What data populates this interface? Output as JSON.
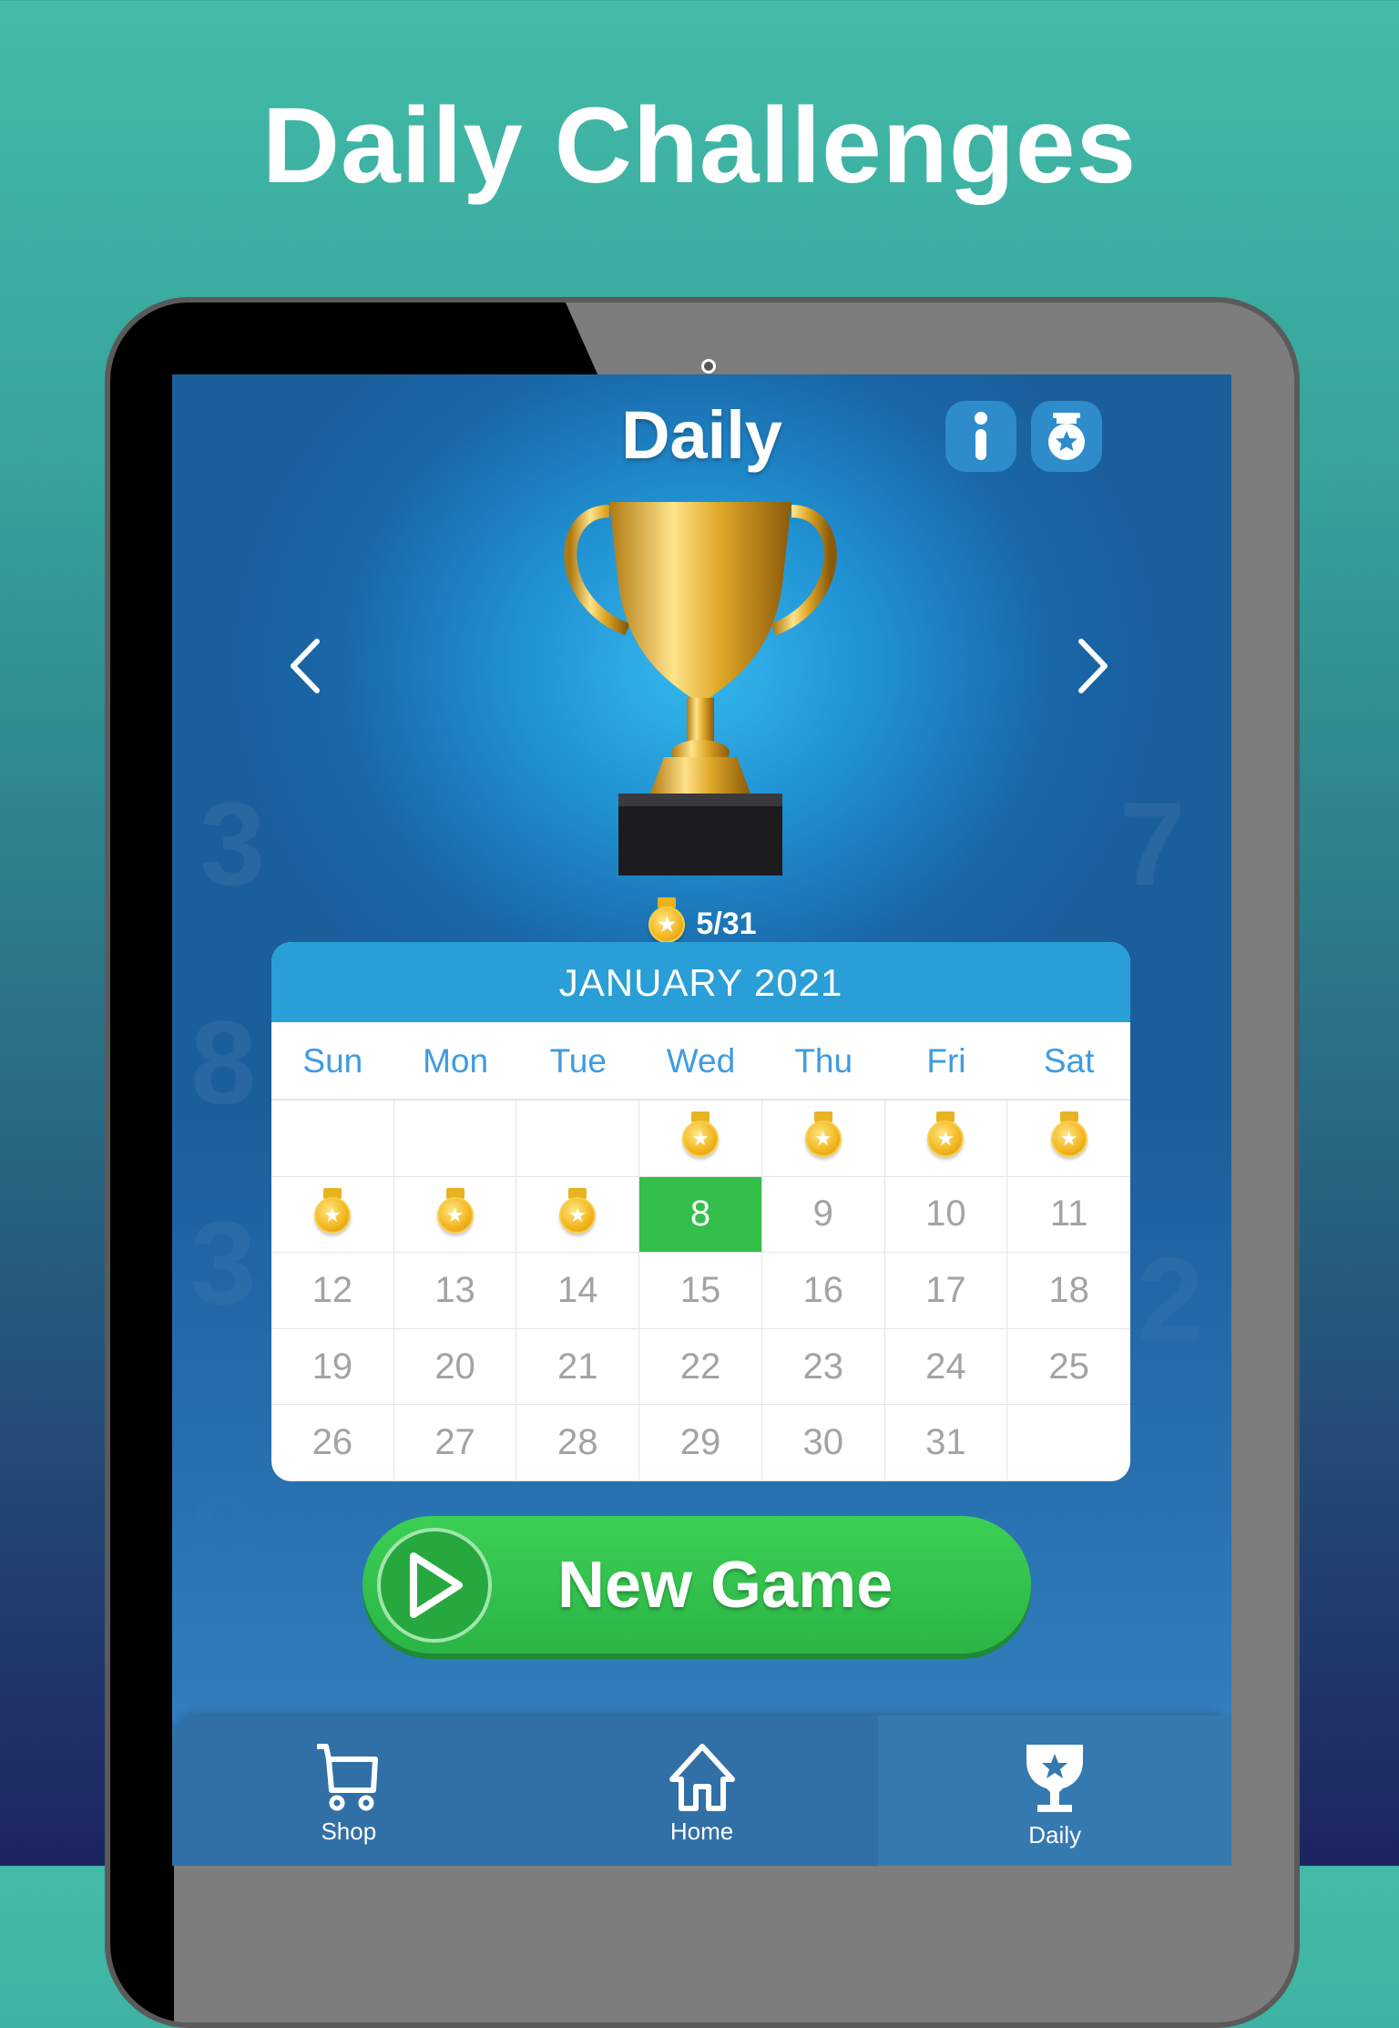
{
  "promo_title": "Daily Challenges",
  "screen": {
    "title": "Daily",
    "buttons": {
      "info_icon": "info-icon",
      "medal_jar_icon": "medal-jar-icon"
    },
    "progress": {
      "completed": 5,
      "total": 31,
      "label": "5/31"
    },
    "calendar": {
      "month_label": "JANUARY 2021",
      "weekdays": [
        "Sun",
        "Mon",
        "Tue",
        "Wed",
        "Thu",
        "Fri",
        "Sat"
      ],
      "today": 8,
      "completed_days": [
        1,
        2,
        3,
        4,
        5,
        6,
        7
      ],
      "cells": [
        "",
        "",
        "",
        "1",
        "2",
        "3",
        "4",
        "5",
        "6",
        "7",
        "8",
        "9",
        "10",
        "11",
        "12",
        "13",
        "14",
        "15",
        "16",
        "17",
        "18",
        "19",
        "20",
        "21",
        "22",
        "23",
        "24",
        "25",
        "26",
        "27",
        "28",
        "29",
        "30",
        "31",
        ""
      ]
    },
    "new_game_label": "New Game",
    "colors": {
      "today": "#33bf49",
      "accent": "#2a9ed6",
      "weekday": "#3f9be0"
    }
  },
  "nav": {
    "items": [
      {
        "label": "Shop",
        "icon": "cart-icon"
      },
      {
        "label": "Home",
        "icon": "home-icon"
      },
      {
        "label": "Daily",
        "icon": "trophy-icon",
        "active": true
      }
    ]
  }
}
